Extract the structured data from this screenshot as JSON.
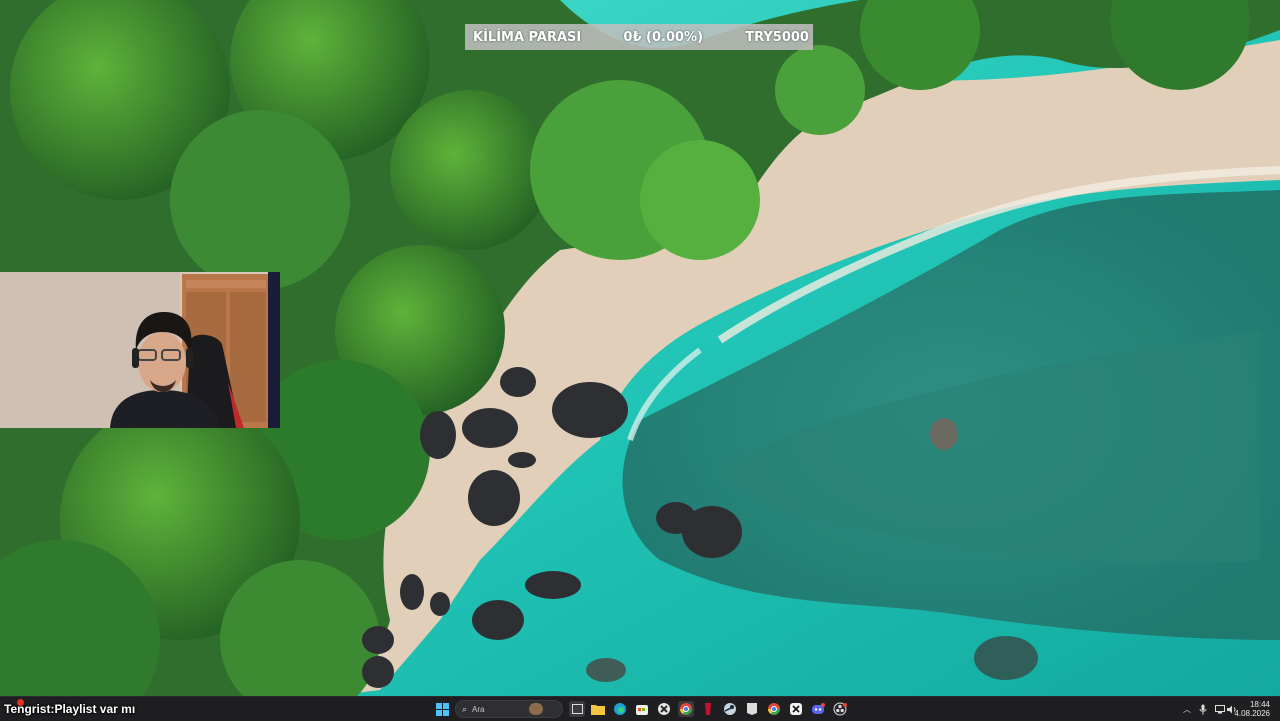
{
  "goal": {
    "label": "KİLİMA PARASI",
    "progress_text": "0₺ (0.00%)",
    "progress": 0,
    "target_text": "TRY5000"
  },
  "chat": {
    "username": "Tengrist",
    "separator": " : ",
    "message": "Playlist var mı"
  },
  "taskbar": {
    "search_placeholder": "Ara",
    "pinned_icons": [
      "windows-start-icon",
      "search-icon",
      "task-view-icon",
      "file-explorer-icon",
      "edge-icon",
      "store-icon",
      "xbox-icon",
      "chrome-icon",
      "red-app-icon",
      "steam-icon",
      "epic-games-icon",
      "chrome-alt-icon",
      "capcut-icon",
      "discord-icon",
      "obs-icon"
    ],
    "accent_color": "#4cc2ff"
  },
  "tray": {
    "time": "18:44",
    "date": "4.08.2026",
    "icons": [
      "chevron-up-icon",
      "microphone-icon",
      "network-icon",
      "volume-icon"
    ]
  }
}
